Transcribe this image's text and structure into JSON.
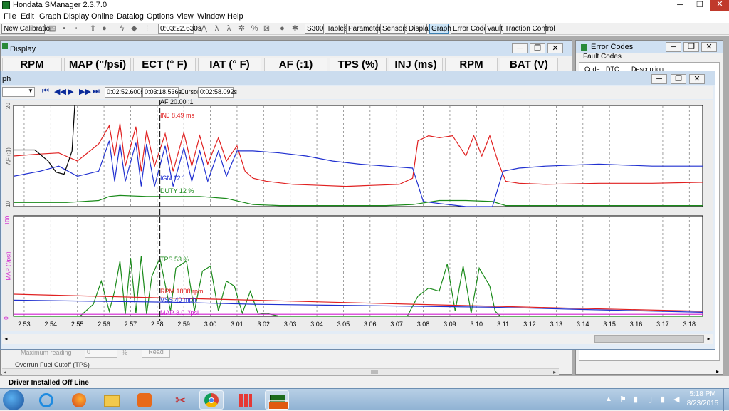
{
  "app": {
    "title": "Hondata SManager 2.3.7.0"
  },
  "menu": [
    "File",
    "Edit",
    "Graph",
    "Display",
    "Online",
    "Datalog",
    "Options",
    "View",
    "Window",
    "Help"
  ],
  "toolbar": {
    "new_calibration": "New Calibration",
    "time_value": "0:03:22.630s",
    "buttons": [
      "S300",
      "Tables",
      "Parameters",
      "Sensors",
      "Display",
      "Graph",
      "Error Codes",
      "Vault",
      "Traction Control"
    ],
    "active": "Graph"
  },
  "display_window": {
    "title": "Display",
    "gauges": [
      "RPM",
      "MAP (\"/psi)",
      "ECT (° F)",
      "IAT (° F)",
      "AF (:1)",
      "TPS (%)",
      "INJ (ms)",
      "RPM",
      "BAT (V)"
    ]
  },
  "error_window": {
    "title": "Error Codes",
    "tab": "Fault Codes",
    "columns": [
      "Code",
      "DTC",
      "Description"
    ]
  },
  "behind_content": {
    "max_reading_label": "Maximum reading",
    "max_reading_value": "0",
    "unit": "%",
    "read_button": "Read",
    "overrun_label": "Overrun Fuel Cutoff (TPS)"
  },
  "graph_window": {
    "title_fragment": "ph",
    "times": {
      "t1": "0:02:52.600s",
      "t2": "0:03:18.536s",
      "cursor_label": "Cursor",
      "t3": "0:02:58.092s"
    },
    "cursor_af_label": "AF 20.00 :1",
    "top_axis_label": "AF (:1)",
    "top_ymax": "20",
    "top_ymin": "10",
    "bottom_axis_label": "MAP (\"/psi)",
    "bottom_ymax": "100",
    "bottom_ymin": "0",
    "cursor_labels_top": [
      {
        "text": "INJ 8.49 ms",
        "color": "#e02020"
      },
      {
        "text": "IGN 12 °",
        "color": "#2030d0"
      },
      {
        "text": "DUTY 12 %",
        "color": "#1a8a1a"
      }
    ],
    "cursor_labels_bottom": [
      {
        "text": "TPS 53 %",
        "color": "#1a8a1a"
      },
      {
        "text": "RPM 1808 rpm",
        "color": "#e02020"
      },
      {
        "text": "VSS 40 mph",
        "color": "#2030d0"
      },
      {
        "text": "MAP 3.0 \"/psi",
        "color": "#d020d0"
      }
    ],
    "x_ticks": [
      "2:53",
      "2:54",
      "2:55",
      "2:56",
      "2:57",
      "2:58",
      "2:59",
      "3:00",
      "3:01",
      "3:02",
      "3:03",
      "3:04",
      "3:05",
      "3:06",
      "3:07",
      "3:08",
      "3:09",
      "3:10",
      "3:11",
      "3:12",
      "3:13",
      "3:14",
      "3:15",
      "3:16",
      "3:17",
      "3:18"
    ],
    "cursor_time": "2:58"
  },
  "chart_data": {
    "type": "line",
    "x_range": [
      "2:52.6",
      "3:18.5"
    ],
    "panels": [
      {
        "name": "top",
        "ylabel": "AF (:1)",
        "ylim": [
          10,
          20
        ],
        "series": [
          {
            "name": "INJ",
            "color": "#e02020",
            "x": [
              0,
              1,
              1.7,
              2.4,
              3.2,
              3.6,
              3.8,
              4.0,
              4.2,
              4.6,
              4.8,
              5.0,
              5.3,
              5.7,
              6.0,
              6.4,
              6.7,
              7.0,
              7.3,
              7.7,
              8.0,
              8.4,
              8.7,
              9.0,
              9.5,
              10.5,
              11.5,
              12.5,
              13.5,
              14.5,
              15.0,
              15.2,
              15.6,
              16.0,
              16.5,
              17.0,
              17.3,
              17.6,
              17.9,
              18.2,
              18.5,
              19.0,
              20.0,
              22.0,
              24.0,
              25.9
            ],
            "y": [
              15.0,
              15.2,
              15.3,
              14.5,
              16.2,
              18.0,
              15.0,
              18.2,
              14.0,
              17.9,
              13.5,
              17.5,
              14.0,
              17.2,
              13.5,
              17.3,
              14.0,
              17.0,
              14.2,
              16.8,
              14.5,
              16.0,
              13.5,
              12.8,
              12.5,
              12.2,
              12.1,
              12.0,
              12.1,
              12.2,
              12.8,
              16.5,
              17.0,
              16.8,
              17.0,
              15.0,
              17.0,
              15.0,
              17.0,
              14.5,
              12.5,
              12.3,
              12.2,
              12.3,
              12.3,
              12.4
            ]
          },
          {
            "name": "IGN",
            "color": "#2030d0",
            "x": [
              0,
              1,
              1.7,
              2.4,
              3.2,
              3.6,
              3.8,
              4.0,
              4.2,
              4.6,
              4.8,
              5.0,
              5.3,
              5.7,
              6.0,
              6.4,
              6.7,
              7.0,
              7.3,
              7.7,
              8.0,
              8.4,
              9.0,
              10.0,
              11.0,
              12.0,
              13.0,
              14.0,
              15.0,
              15.4,
              16.0,
              17.0,
              18.0,
              18.4,
              19.0,
              20.0,
              22.0,
              24.0,
              25.9
            ],
            "y": [
              13.0,
              13.5,
              14.0,
              13.0,
              13.5,
              16.5,
              12.5,
              16.2,
              12.5,
              16.3,
              12.0,
              16.2,
              12.0,
              16.0,
              12.0,
              15.8,
              12.5,
              15.5,
              12.5,
              15.5,
              13.0,
              15.5,
              15.5,
              15.3,
              15.0,
              14.5,
              14.2,
              14.0,
              13.8,
              10.5,
              10.3,
              10.0,
              10.0,
              13.5,
              13.8,
              14.0,
              14.2,
              14.0,
              14.0
            ]
          },
          {
            "name": "DUTY",
            "color": "#1a8a1a",
            "x": [
              0,
              2,
              3.2,
              3.6,
              4.0,
              5.0,
              6.0,
              7.0,
              8.0,
              9.0,
              10.0,
              12.0,
              14.0,
              15.0,
              16.0,
              17.0,
              18.0,
              18.5,
              20.0,
              25.9
            ],
            "y": [
              10.4,
              10.4,
              10.6,
              11.0,
              11.1,
              11.0,
              11.0,
              11.0,
              10.8,
              10.2,
              10.1,
              10.1,
              10.1,
              10.2,
              10.6,
              10.6,
              10.5,
              10.1,
              10.1,
              10.1
            ]
          },
          {
            "name": "AF",
            "color": "#000000",
            "x": [
              0,
              0.8,
              1.3,
              1.6,
              1.9,
              2.2,
              2.3
            ],
            "y": [
              15.6,
              15.6,
              14.5,
              13.4,
              13.2,
              15.5,
              20.0
            ]
          }
        ]
      },
      {
        "name": "bottom",
        "ylabel": "MAP (\"/psi)",
        "ylim": [
          0,
          100
        ],
        "series": [
          {
            "name": "TPS",
            "color": "#1a8a1a",
            "x": [
              0,
              2.5,
              3.0,
              3.3,
              3.6,
              3.8,
              4.0,
              4.2,
              4.4,
              4.6,
              4.8,
              5.0,
              5.2,
              5.5,
              5.9,
              6.1,
              6.5,
              6.8,
              7.1,
              7.4,
              7.7,
              8.0,
              8.3,
              8.6,
              8.9,
              9.2,
              9.5,
              10.0,
              14.8,
              15.2,
              15.6,
              16.0,
              16.3,
              16.6,
              16.9,
              17.2,
              17.5,
              17.9,
              18.1,
              18.3,
              25.9
            ],
            "y": [
              0,
              0,
              12,
              35,
              5,
              25,
              55,
              2,
              58,
              3,
              60,
              2,
              40,
              58,
              5,
              48,
              55,
              5,
              45,
              50,
              5,
              35,
              30,
              3,
              25,
              2,
              3,
              0,
              0,
              20,
              28,
              25,
              52,
              5,
              50,
              3,
              48,
              30,
              5,
              0,
              0
            ]
          },
          {
            "name": "RPM",
            "color": "#e02020",
            "x": [
              0,
              3,
              6,
              9,
              12,
              15,
              18,
              21,
              25.9
            ],
            "y": [
              22,
              20,
              18,
              16,
              14,
              12,
              10,
              8,
              5
            ]
          },
          {
            "name": "VSS",
            "color": "#2030d0",
            "x": [
              0,
              3,
              6,
              9,
              12,
              15,
              18,
              21,
              25.9
            ],
            "y": [
              16,
              15,
              14,
              12,
              11,
              10,
              9,
              7,
              4
            ]
          },
          {
            "name": "MAP",
            "color": "#d020d0",
            "x": [
              0,
              5,
              10,
              15,
              20,
              25.9
            ],
            "y": [
              2,
              2,
              2,
              2,
              2,
              2
            ]
          }
        ]
      }
    ],
    "x_tick_labels": [
      "2:53",
      "2:54",
      "2:55",
      "2:56",
      "2:57",
      "2:58",
      "2:59",
      "3:00",
      "3:01",
      "3:02",
      "3:03",
      "3:04",
      "3:05",
      "3:06",
      "3:07",
      "3:08",
      "3:09",
      "3:10",
      "3:11",
      "3:12",
      "3:13",
      "3:14",
      "3:15",
      "3:16",
      "3:17",
      "3:18"
    ],
    "cursor_x": 5.5,
    "grid": true
  },
  "statusbar": {
    "left": "Driver Installed",
    "right": "Off Line"
  },
  "taskbar": {
    "apps": [
      "start-orb",
      "internet-explorer",
      "firefox",
      "file-explorer",
      "media-player",
      "snipping-tool",
      "chrome",
      "app-grid",
      "ecu-app",
      "s300-app"
    ],
    "clock_time": "5:18 PM",
    "clock_date": "8/23/2015"
  }
}
